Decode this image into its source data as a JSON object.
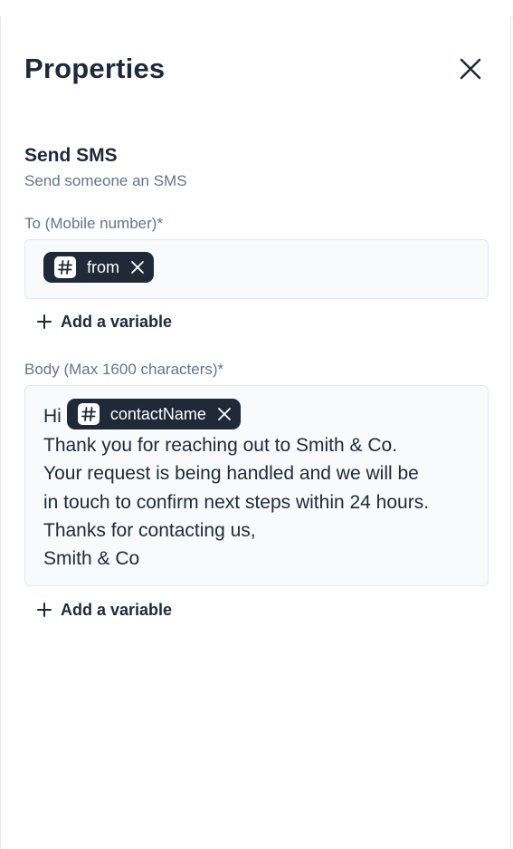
{
  "panel": {
    "title": "Properties"
  },
  "action": {
    "title": "Send SMS",
    "description": "Send someone an SMS"
  },
  "to_field": {
    "label": "To (Mobile number)*",
    "variables": [
      {
        "label": "from"
      }
    ],
    "add_variable_label": "Add a variable"
  },
  "body_field": {
    "label": "Body (Max 1600 characters)*",
    "prefix": "Hi",
    "variable": {
      "label": "contactName"
    },
    "lines": [
      "Thank you for reaching out to Smith & Co.",
      "Your request is being handled and we will be",
      "in touch to confirm next steps within 24 hours.",
      "Thanks for contacting us,",
      "Smith & Co"
    ],
    "add_variable_label": "Add a variable"
  },
  "icons": {
    "close": "close-icon",
    "hash": "hash-icon",
    "chip_remove": "close-icon",
    "add": "plus-icon"
  },
  "colors": {
    "chip_bg": "#1f2937",
    "field_bg": "#f8fafc",
    "label": "#64748b",
    "heading": "#1e293b"
  }
}
